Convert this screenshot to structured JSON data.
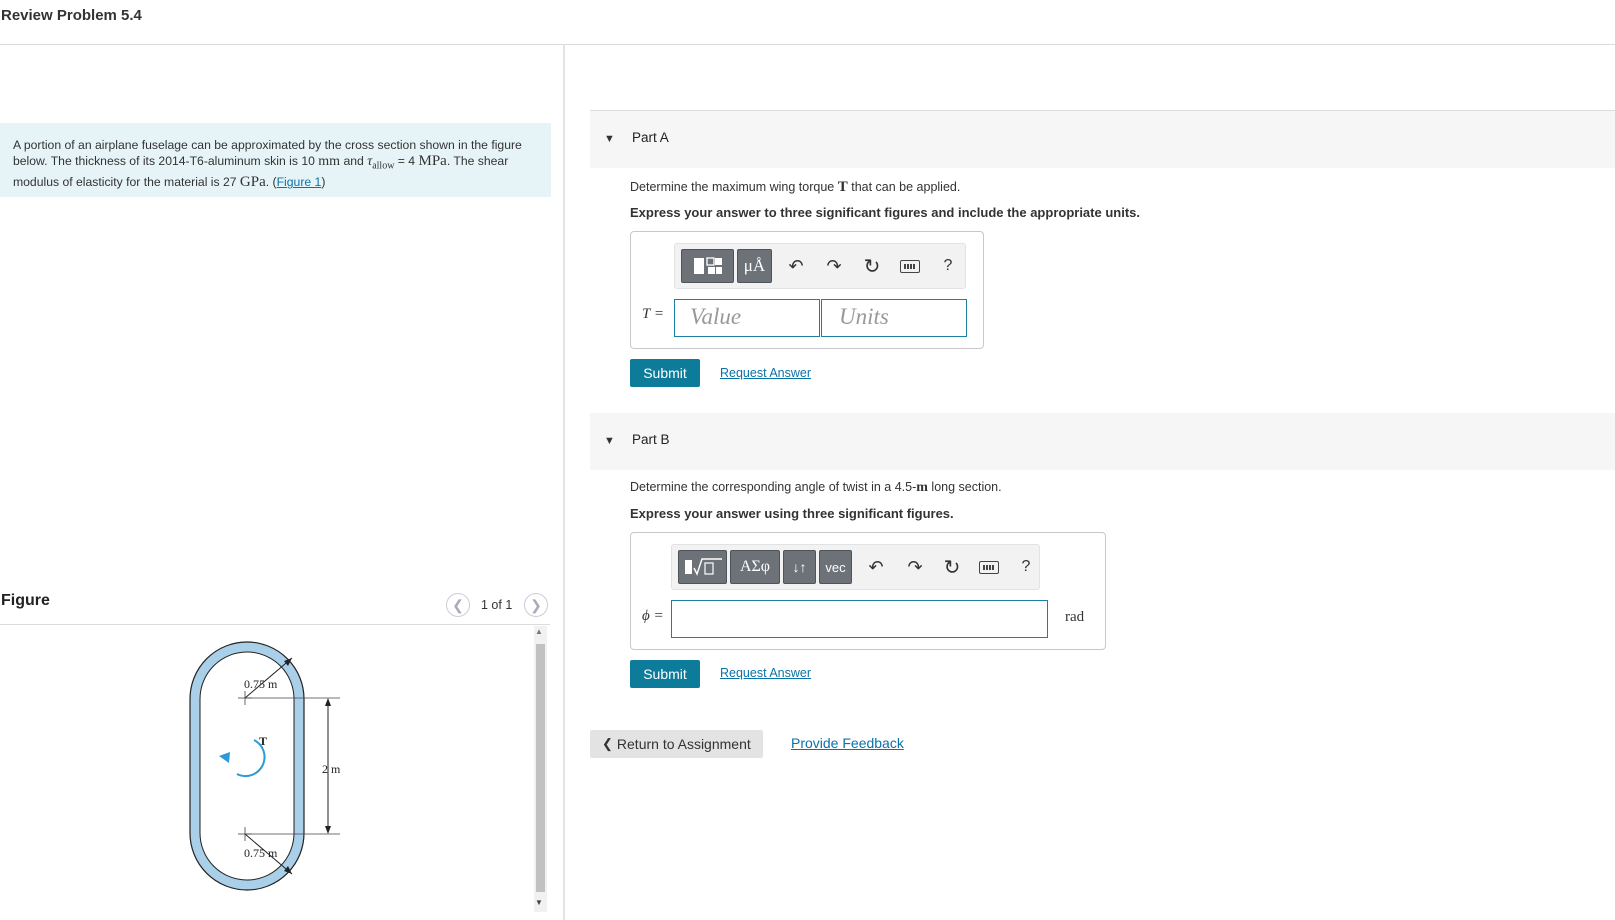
{
  "page": {
    "title": "Review Problem 5.4"
  },
  "problem": {
    "text_1": "A portion of an airplane fuselage can be approximated by the cross section shown in the figure below. The thickness of its 2014-T6-aluminum skin is 10 ",
    "unit_mm": "mm",
    "text_2": " and ",
    "tau": "τ",
    "tau_sub": "allow",
    "text_3": " = 4 ",
    "unit_mpa": "MPa",
    "text_4": ". The shear modulus of elasticity for the material is 27 ",
    "unit_gpa": "GPa",
    "text_5": ". (",
    "figure_link": "Figure 1",
    "text_6": ")"
  },
  "figure": {
    "heading": "Figure",
    "pager": "1 of 1",
    "prev_icon": "chevron-left-icon",
    "next_icon": "chevron-right-icon",
    "labels": {
      "top_radius": "0.75 m",
      "bottom_radius": "0.75 m",
      "torque": "T",
      "height": "2 m"
    },
    "colors": {
      "skin": "#a9cfe9",
      "torque_arrow": "#2a9bd7"
    }
  },
  "partA": {
    "label": "Part A",
    "question_1": "Determine the maximum wing torque ",
    "question_var": "T",
    "question_2": " that can be applied.",
    "instruction": "Express your answer to three significant figures and include the appropriate units.",
    "toolbar": {
      "templates": "templates-icon",
      "units": "μÅ",
      "undo": "undo-icon",
      "redo": "redo-icon",
      "reset": "reset-icon",
      "keyboard": "keyboard-icon",
      "help": "?"
    },
    "var_label": "T =",
    "value_placeholder": "Value",
    "units_placeholder": "Units",
    "submit": "Submit",
    "request": "Request Answer"
  },
  "partB": {
    "label": "Part B",
    "question_1": "Determine the corresponding angle of twist in a 4.5-",
    "question_unit": "m",
    "question_2": " long section.",
    "instruction": "Express your answer using three significant figures.",
    "toolbar": {
      "templates": "templates-sqrt-icon",
      "greek": "ΑΣφ",
      "arrows": "↓↑",
      "vec": "vec",
      "undo": "undo-icon",
      "redo": "redo-icon",
      "reset": "reset-icon",
      "keyboard": "keyboard-icon",
      "help": "?"
    },
    "var_label": "ϕ =",
    "unit": "rad",
    "submit": "Submit",
    "request": "Request Answer"
  },
  "footer": {
    "return": "Return to Assignment",
    "feedback": "Provide Feedback"
  },
  "colors": {
    "accent": "#0d7c9a",
    "link": "#0b72a8",
    "problem_bg": "#e6f4f7",
    "input_border": "#1d7fa6"
  }
}
